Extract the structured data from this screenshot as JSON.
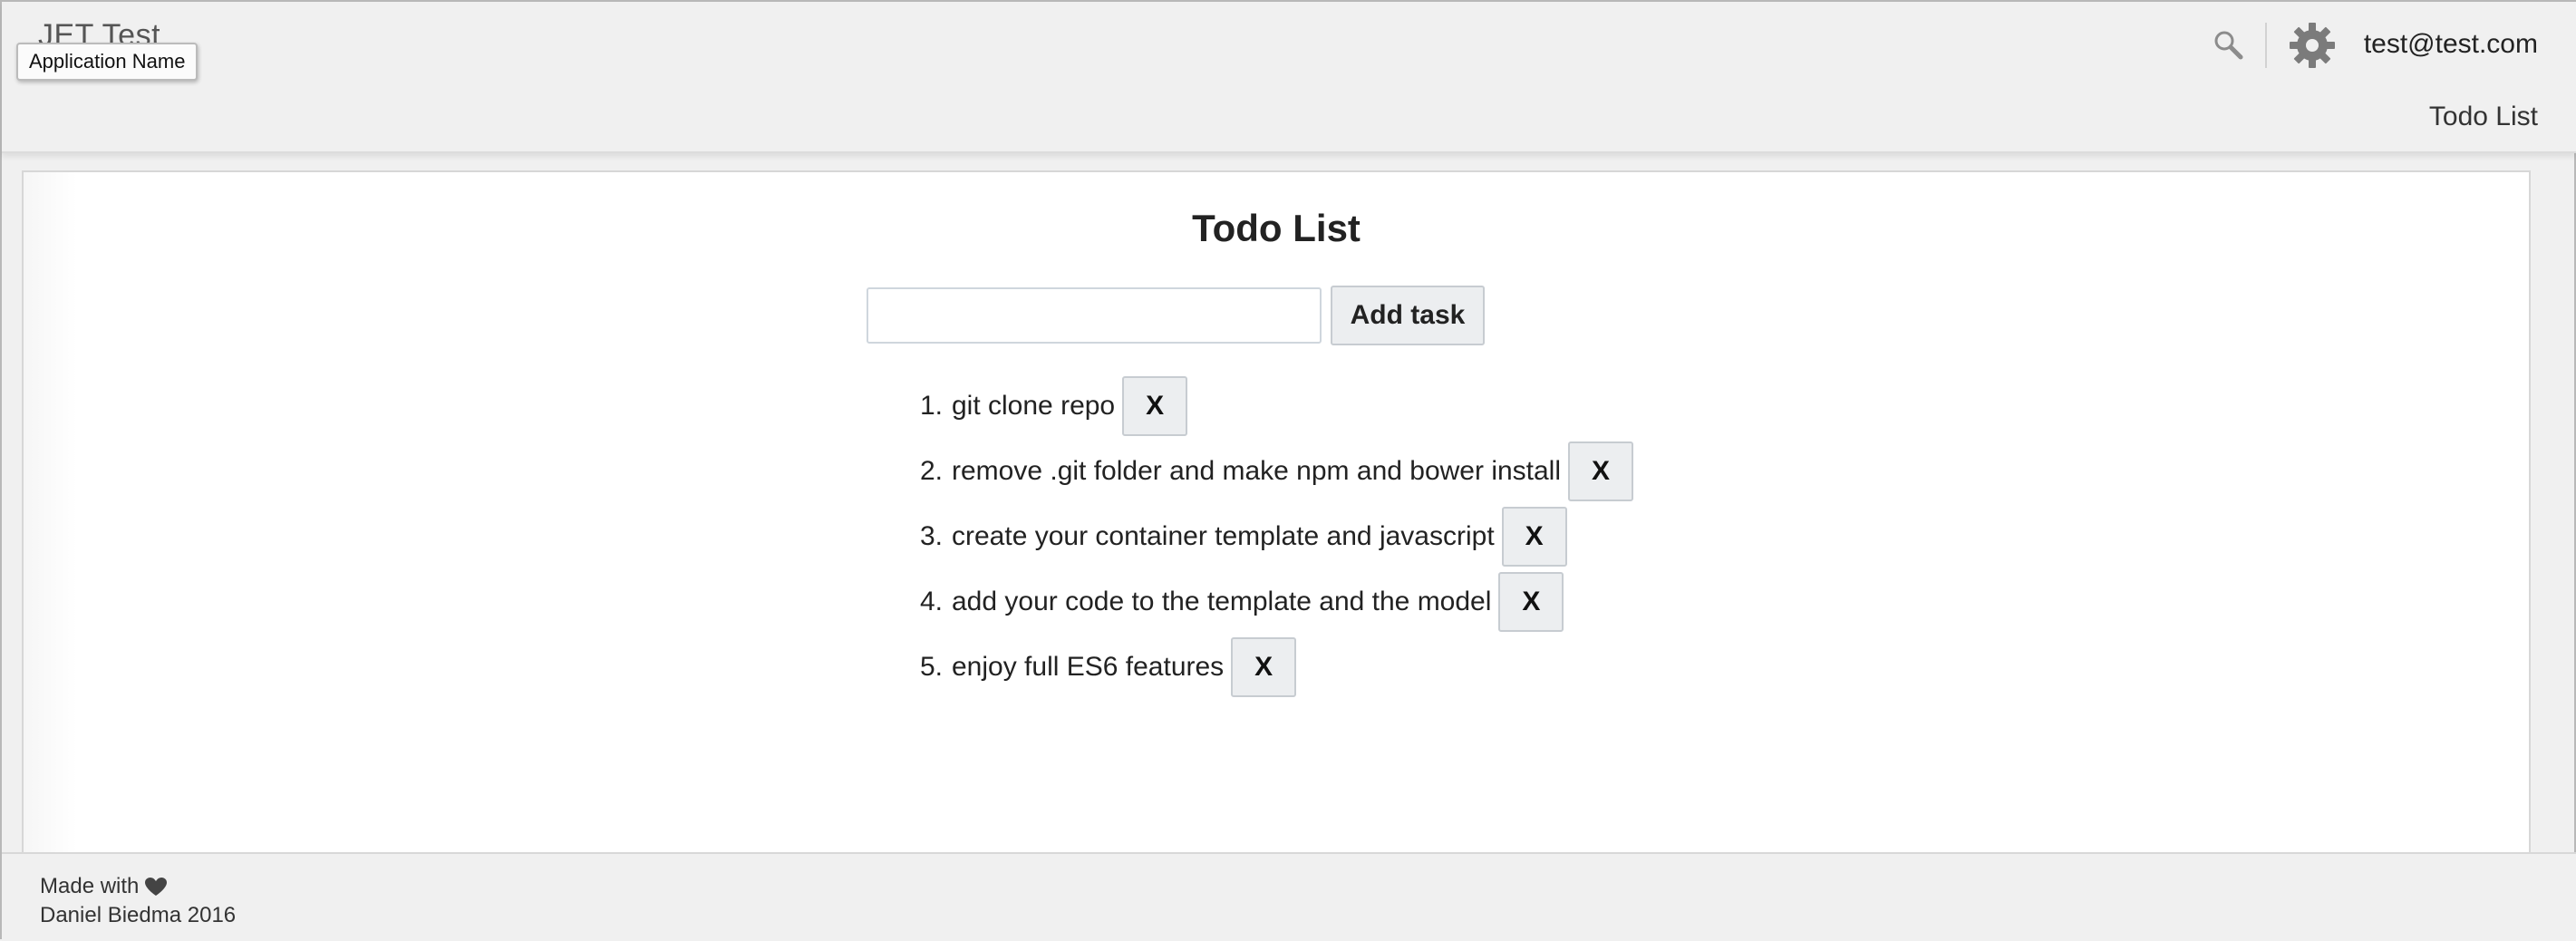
{
  "header": {
    "app_name": "JET Test",
    "tooltip": "Application Name",
    "user_email": "test@test.com",
    "nav_title": "Todo List",
    "icons": [
      "search-icon",
      "gear-icon"
    ]
  },
  "main": {
    "title": "Todo List",
    "input_value": "",
    "add_button_label": "Add task",
    "tasks": [
      {
        "number": "1.",
        "text": "git clone repo",
        "delete_label": "X"
      },
      {
        "number": "2.",
        "text": "remove .git folder and make npm and bower install",
        "delete_label": "X"
      },
      {
        "number": "3.",
        "text": "create your container template and javascript",
        "delete_label": "X"
      },
      {
        "number": "4.",
        "text": "add your code to the template and the model",
        "delete_label": "X"
      },
      {
        "number": "5.",
        "text": "enjoy full ES6 features",
        "delete_label": "X"
      }
    ]
  },
  "footer": {
    "made_with": "Made with",
    "heart_icon": "heart-icon",
    "credit": "Daniel Biedma 2016"
  },
  "colors": {
    "background": "#f0f0f0",
    "panel": "#ffffff",
    "button": "#eceef0",
    "text": "#222222"
  }
}
